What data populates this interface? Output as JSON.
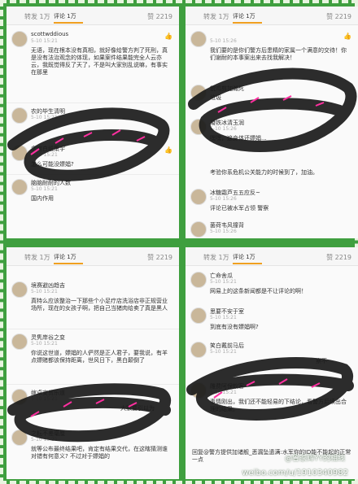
{
  "tabs": {
    "repost": "转发 1万",
    "comment": "评论 1万",
    "like": "赞 2219"
  },
  "panels": [
    {
      "comments": [
        {
          "name": "scottwddious",
          "time": "5-10 15:21",
          "body": "无语，现在根本没有真相，就好像给警方判了死刑，真是没有法治观念的体现，如果案件结果能完全人云亦云，我既觉得反了天了，不是叫大家别乱说嘛，有事实在那里"
        },
        {
          "name": "农的毕生清明",
          "time": "5-10 15:21",
          "body": ""
        },
        {
          "name": "念宛白纸策宇",
          "time": "5-10 15:21",
          "body": "怎么可能没嫖娼?"
        },
        {
          "name": "脑脑耐耐的人数",
          "time": "5-10 15:21",
          "body": "国内作用"
        }
      ]
    },
    {
      "comments": [
        {
          "name": "",
          "time": "5-10 15:26",
          "body": "我们要的是你们警方后患精的家属一个满意的交待！你们谢耐的本事案出来去找我解决！"
        },
        {
          "name": "貌鸡剪加瀚死",
          "time": "",
          "body": "垃圾"
        },
        {
          "name": "凝铁冰清玉润",
          "time": "5-10 15:26",
          "body": "嘿嘿，这身体还嫖娼..."
        },
        {
          "name": "",
          "time": "",
          "body": "考验你系危机公关能力的时候到了，加油。"
        },
        {
          "name": "冰糖霜芦五五应反~",
          "time": "5-10 15:26",
          "body": "评论已被水军占领 警察"
        },
        {
          "name": "菌荷韦风撞背",
          "time": "5-10 15:26",
          "body": ""
        }
      ]
    },
    {
      "comments": [
        {
          "name": "境赛避凶趋吉",
          "time": "5-10 15:21",
          "body": "真特么应该整治一下那些个小足疗店洗浴店非正规营业场所，现在的女孩子啊，把自己当猪肉给卖了真是黑人"
        },
        {
          "name": "灵隽岸谷之变",
          "time": "5-10 15:21",
          "body": "你说这世道，嫖娼的人俨然是正人君子，要我说，有羊点嫖赌都该保持距离，世风日下，黑白颠倒了"
        },
        {
          "name": "嫁卓安贫乐道",
          "time": "5-10 15:21",
          "body": "大家要引以为"
        },
        {
          "name": "之耘不差毫厘",
          "time": "5-10 15:21",
          "body": "就等公布最终结果吧，肯定有结果交代，在这瞎猜测谁对错有何意义? 不过对于嫖娼的"
        }
      ]
    },
    {
      "comments": [
        {
          "name": "亡命舍瓜",
          "time": "5-10 15:21",
          "body": "网易上的这条新闻都是不让评论的啊！"
        },
        {
          "name": "思要不安于室",
          "time": "5-10 15:21",
          "body": "到底有没有嫖娼啊?"
        },
        {
          "name": "笑白戴前马后",
          "time": "5-10 15:21",
          "body": "察不"
        },
        {
          "name": "雕费阿保蚁客",
          "time": "5-10 15:21",
          "body": "事情刚出，我们还不能轻易的下结论，看警方后续出合理的结果。"
        },
        {
          "name": "",
          "time": "",
          "body": "回复@警方提供加诸舰_恶漏坠遗满:水军你的ID能不能起的正常一点"
        }
      ]
    }
  ],
  "watermark": {
    "line1": "@鲁家辉YY的相线",
    "line2": "weibo.com/u/1910340982"
  },
  "colors": {
    "tab_underline": "#f0a020",
    "scribble": "#1a1a1a",
    "scribble_accent": "#ff2fa0",
    "frame": "#3f9f3f"
  },
  "icons": [
    "thumb-up-icon",
    "avatar"
  ]
}
